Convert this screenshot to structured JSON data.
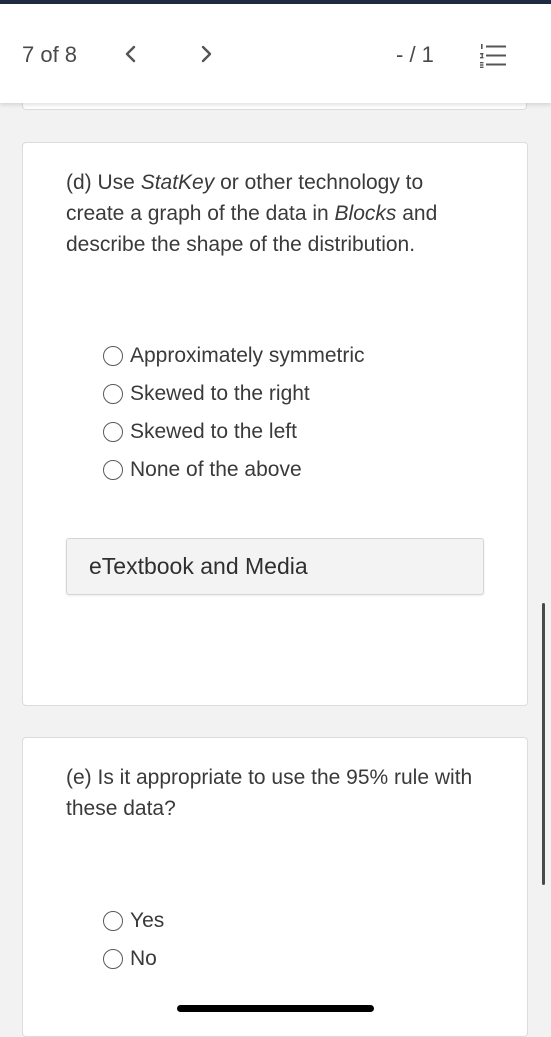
{
  "header": {
    "position_text": "7 of 8",
    "prev_icon": "chevron-left-icon",
    "next_icon": "chevron-right-icon",
    "score_text": "- / 1",
    "list_icon": "numbered-list-icon"
  },
  "question_d": {
    "prefix": "(d) Use ",
    "statkey": "StatKey",
    "middle": " or other technology to create a graph of the data in ",
    "blocks": "Blocks",
    "suffix": " and describe the shape of the distribution.",
    "options": [
      "Approximately symmetric",
      "Skewed to the right",
      "Skewed to the left",
      "None of the above"
    ],
    "etextbook_label": "eTextbook and Media"
  },
  "question_e": {
    "text": "(e) Is it appropriate to use the 95% rule with these data?",
    "options": [
      "Yes",
      "No"
    ]
  },
  "colors": {
    "top_border": "#1f2a44",
    "text": "#3a3a3a",
    "background": "#f2f2f2"
  }
}
